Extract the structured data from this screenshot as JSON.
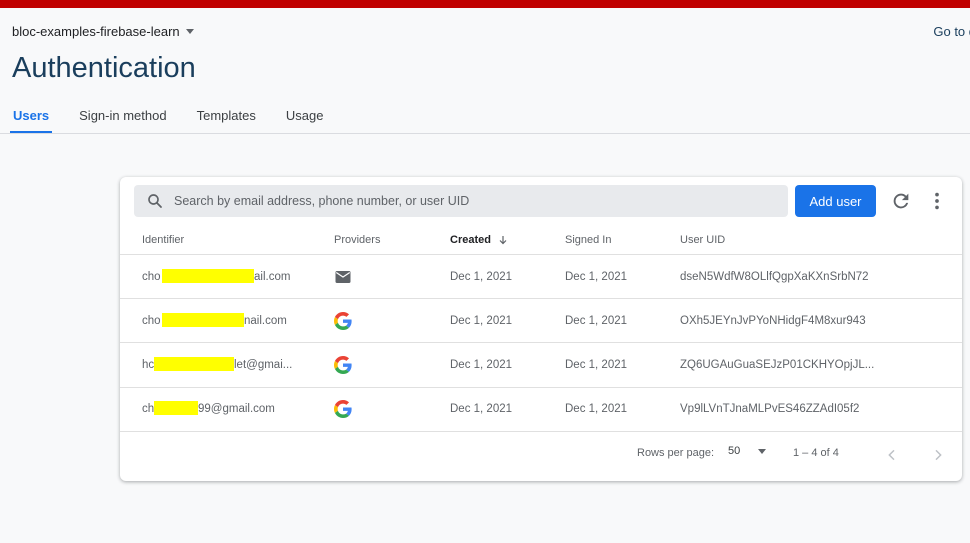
{
  "project": {
    "name": "bloc-examples-firebase-learn"
  },
  "header": {
    "goto": "Go to d",
    "title": "Authentication"
  },
  "tabs": [
    {
      "label": "Users",
      "active": true
    },
    {
      "label": "Sign-in method",
      "active": false
    },
    {
      "label": "Templates",
      "active": false
    },
    {
      "label": "Usage",
      "active": false
    }
  ],
  "search": {
    "placeholder": "Search by email address, phone number, or user UID"
  },
  "toolbar": {
    "add_user_label": "Add user",
    "refresh_icon": "refresh-icon",
    "more_icon": "more-vert-icon"
  },
  "table": {
    "columns": [
      "Identifier",
      "Providers",
      "Created",
      "Signed In",
      "User UID"
    ],
    "sorted_column": "Created",
    "sort_direction": "descending",
    "rows": [
      {
        "identifier_start": "cho",
        "identifier_end": "ail.com",
        "provider": "email",
        "created": "Dec 1, 2021",
        "signed_in": "Dec 1, 2021",
        "uid": "dseN5WdfW8OLlfQgpXaKXnSrbN72"
      },
      {
        "identifier_start": "cho",
        "identifier_end": "nail.com",
        "provider": "google",
        "created": "Dec 1, 2021",
        "signed_in": "Dec 1, 2021",
        "uid": "OXh5JEYnJvPYoNHidgF4M8xur943"
      },
      {
        "identifier_start": "hc",
        "identifier_end": "let@gmai...",
        "provider": "google",
        "created": "Dec 1, 2021",
        "signed_in": "Dec 1, 2021",
        "uid": "ZQ6UGAuGuaSEJzP01CKHYOpjJL..."
      },
      {
        "identifier_start": "ch",
        "identifier_end": "99@gmail.com",
        "provider": "google",
        "created": "Dec 1, 2021",
        "signed_in": "Dec 1, 2021",
        "uid": "Vp9lLVnTJnaMLPvES46ZZAdI05f2"
      }
    ]
  },
  "pagination": {
    "rows_per_page_label": "Rows per page:",
    "rows_per_page": "50",
    "range": "1 – 4 of 4"
  },
  "colors": {
    "accent": "#1a73e8",
    "title": "#1a3e5c",
    "topbar": "#c00000",
    "redaction": "#ffff00"
  }
}
